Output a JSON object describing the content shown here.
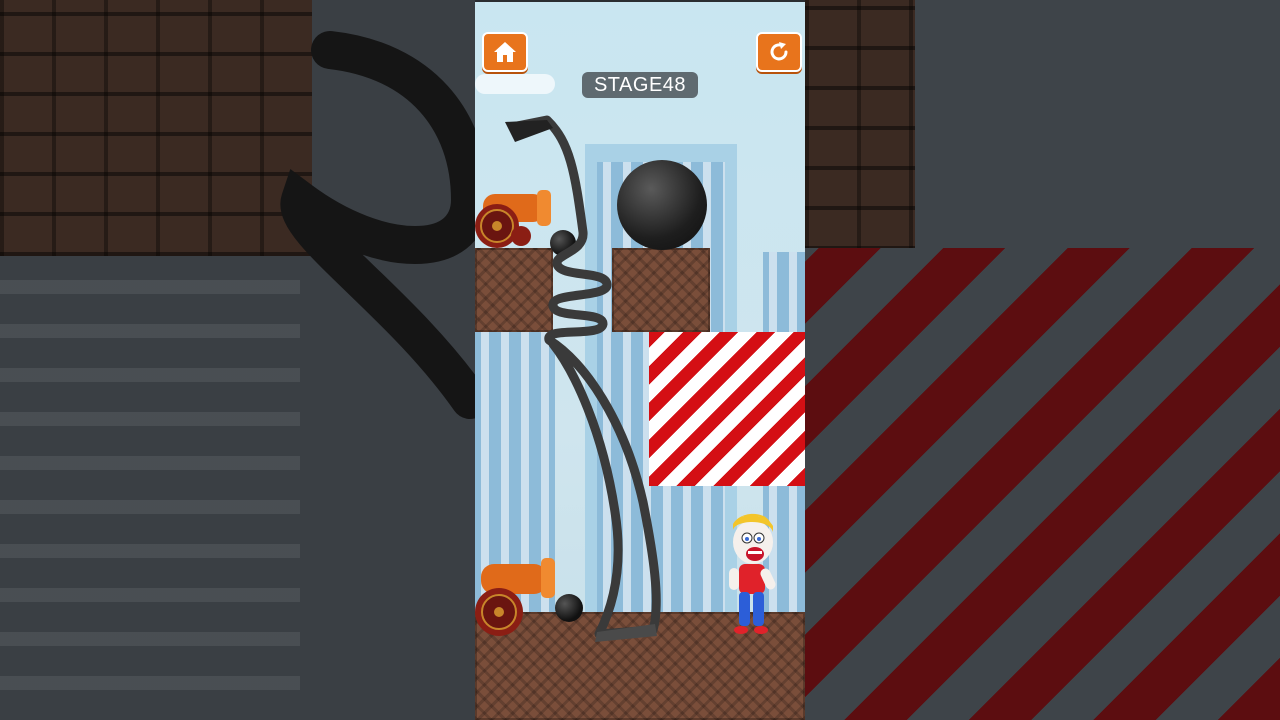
{
  "game": {
    "stage_label": "STAGE48",
    "home_button": {
      "icon": "home-icon"
    },
    "restart_button": {
      "icon": "restart-icon"
    }
  },
  "colors": {
    "button_orange": "#e8741c",
    "hazard_red": "#d40f14",
    "brick_brown": "#7a4e3a",
    "sky": "#c9e6f1",
    "stage_badge": "#5f6a70"
  }
}
